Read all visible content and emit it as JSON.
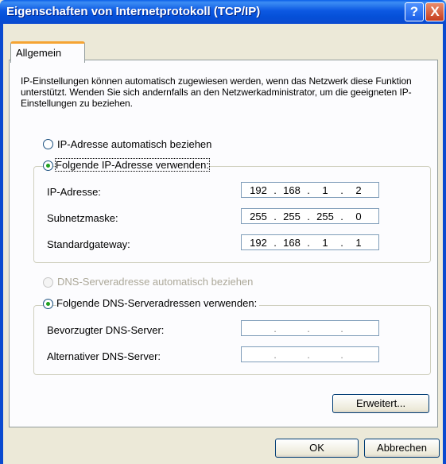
{
  "window": {
    "title": "Eigenschaften von Internetprotokoll (TCP/IP)",
    "help_button": "?",
    "close_button": "X"
  },
  "tabs": [
    {
      "label": "Allgemein",
      "active": true
    }
  ],
  "description": "IP-Einstellungen können automatisch zugewiesen werden, wenn das Netzwerk diese Funktion unterstützt. Wenden Sie sich andernfalls an den Netzwerkadministrator, um die geeigneten IP-Einstellungen zu beziehen.",
  "ip_section": {
    "auto_label": "IP-Adresse automatisch beziehen",
    "manual_label": "Folgende IP-Adresse verwenden:",
    "selected": "manual",
    "fields": [
      {
        "label": "IP-Adresse:",
        "octets": [
          "192",
          "168",
          "1",
          "2"
        ]
      },
      {
        "label": "Subnetzmaske:",
        "octets": [
          "255",
          "255",
          "255",
          "0"
        ]
      },
      {
        "label": "Standardgateway:",
        "octets": [
          "192",
          "168",
          "1",
          "1"
        ]
      }
    ]
  },
  "dns_section": {
    "auto_label": "DNS-Serveradresse automatisch beziehen",
    "auto_enabled": false,
    "manual_label": "Folgende DNS-Serveradressen verwenden:",
    "selected": "manual",
    "fields": [
      {
        "label": "Bevorzugter DNS-Server:",
        "octets": [
          "",
          "",
          "",
          ""
        ]
      },
      {
        "label": "Alternativer DNS-Server:",
        "octets": [
          "",
          "",
          "",
          ""
        ]
      }
    ]
  },
  "buttons": {
    "advanced": "Erweitert...",
    "ok": "OK",
    "cancel": "Abbrechen"
  },
  "icons": {
    "help": "help-icon",
    "close": "close-icon"
  },
  "colors": {
    "title_bar": "#0a55e0",
    "dialog_bg": "#ece9d8",
    "panel_bg": "#fcfcfe",
    "tab_accent": "#f5a433",
    "radio_dot": "#21a121"
  }
}
